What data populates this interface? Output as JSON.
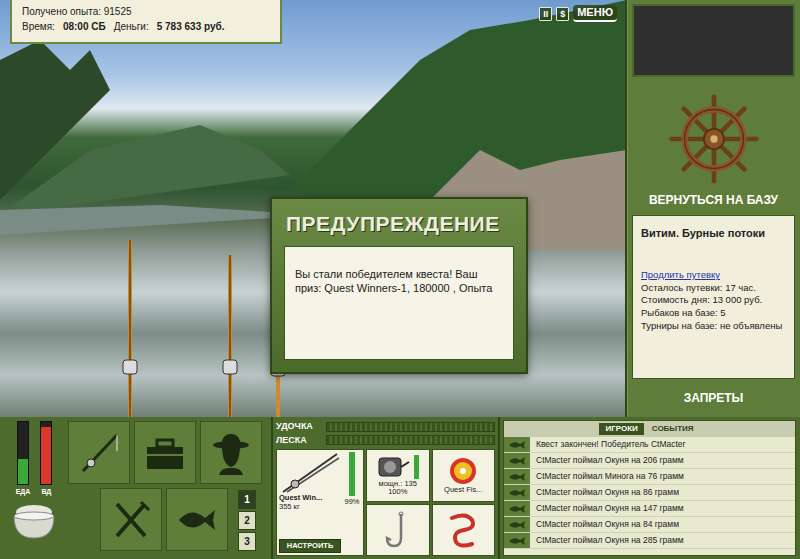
{
  "hud": {
    "experience": "Получено опыта: 91525",
    "time_label": "Время:",
    "time": "08:00 СБ",
    "money_label": "Деньги:",
    "money": "5 783 633 руб."
  },
  "top_buttons": [
    {
      "label": "II",
      "kind": "icon"
    },
    {
      "label": "$",
      "kind": "icon"
    },
    {
      "label": "МЕНЮ",
      "kind": "text"
    }
  ],
  "dialog": {
    "title": "ПРЕДУПРЕЖДЕНИЕ",
    "text": "Вы стали победителем квеста! Ваш приз: Quest Winners-1, 180000 , Опыта"
  },
  "side": {
    "return_button": "ВЕРНУТЬСЯ НА БАЗУ",
    "location": "Витим. Бурные потоки",
    "extend_link": "Продлить путевку",
    "info": [
      "Осталось путевки: 17 час.",
      "Стоимость дня: 13 000 руб.",
      "Рыбаков на базе: 5",
      "Турниры на базе: не объявлены"
    ],
    "bans_button": "ЗАПРЕТЫ"
  },
  "meters": [
    {
      "label": "ЕДА",
      "level": 0.4,
      "color": "#3aa83a"
    },
    {
      "label": "ВД",
      "level": 0.92,
      "color": "#d83a2a"
    }
  ],
  "slots": [
    {
      "label": "1",
      "selected": true
    },
    {
      "label": "2",
      "selected": false
    },
    {
      "label": "3",
      "selected": false
    }
  ],
  "tension": [
    {
      "label": "УДОЧКА",
      "level": 0
    },
    {
      "label": "ЛЕСКА",
      "level": 0
    }
  ],
  "gear": {
    "rod": {
      "name": "Quest Win...",
      "weight": "355 кг",
      "condition": "99%",
      "level": 0.99
    },
    "reel": {
      "power": "мощн.: 135",
      "condition": "100%",
      "level": 1
    },
    "line": {
      "name": "Quest Fis..."
    },
    "setup_button": "НАСТРОИТЬ"
  },
  "chat": {
    "tabs": [
      {
        "label": "ИГРОКИ",
        "selected": true
      },
      {
        "label": "СОБЫТИЯ",
        "selected": false
      }
    ],
    "messages": [
      "Квест закончен! Победитель CtMacter",
      "CtMacter поймал Окуня на 206 грамм",
      "CtMacter поймал Минога на 76 грамм",
      "CtMacter поймал Окуня на 86 грамм",
      "CtMacter поймал Окуня на 147 грамм",
      "CtMacter поймал Окуня на 84 грамм",
      "CtMacter поймал Окуня на 285 грамм"
    ]
  }
}
